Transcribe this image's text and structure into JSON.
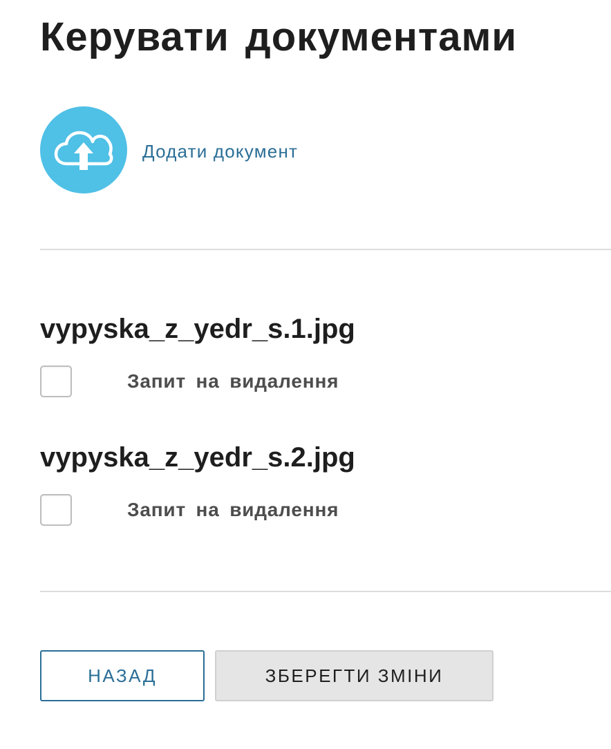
{
  "page": {
    "title": "Керувати документами"
  },
  "upload": {
    "label": "Додати документ",
    "icon": "cloud-upload-icon",
    "circle_color": "#4fc0e6"
  },
  "documents": [
    {
      "filename": "vypyska_z_yedr_s.1.jpg",
      "delete_request_label": "Запит на видалення",
      "checked": false
    },
    {
      "filename": "vypyska_z_yedr_s.2.jpg",
      "delete_request_label": "Запит на видалення",
      "checked": false
    }
  ],
  "actions": {
    "back_label": "НАЗАД",
    "save_label": "ЗБЕРЕГТИ ЗМІНИ"
  },
  "colors": {
    "accent": "#2a6e96",
    "text": "#1e1e1e",
    "muted_text": "#4d4d4d",
    "save_button_bg": "#e5e5e5"
  }
}
